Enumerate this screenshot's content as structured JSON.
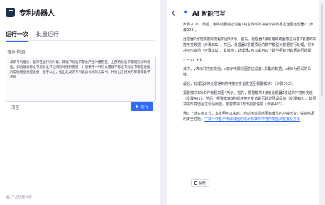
{
  "app": {
    "title": "专利机器人"
  },
  "tabs": [
    {
      "label": "运行一次",
      "active": true
    },
    {
      "label": "批量运行",
      "active": false
    }
  ],
  "form": {
    "section_label": "专利信息",
    "text_value": "发明专利描述：铝吊在运行的时候，其推节标准节都会产生冲撞形变，上部的标准节都成的诊断视图，如何设想标准节与标准节之间的冲撞形变值，计划采用一种可以用数字标准节标准节哪些连接的电磁线圈感应设备，基于以上，给出此发明专利说具体规的文案书，并给出了相关的算法或数学函数",
    "clear_label": "清空",
    "run_label": "运行"
  },
  "watermark": "产品经理大群",
  "panel": {
    "title": "AI 智能书写",
    "paragraphs": [
      "步骤202）。最后，电磁线圈感应设备1将监测到的冲撞形变数据发送至处理器2（步骤203）。",
      "处理器2处理数据的流程如图3所示。首先，处理器2接收电磁线圈感应设备1发送的冲撞形变数据（步骤301）。然后，处理器2根据预设的数学模型对数据进行处理，得到冲撞形变值（步骤302）。具体地，处理器2可以采用以下数学函数对数据进行处理：",
      "y = ax + b",
      "其中，y表示冲撞形变值，x表示电磁线圈感应设备1采集的数据，a和b为预设的系数。",
      "最后，处理器2将处理得到的冲撞形变值发送至报警模块3（步骤303）。",
      "报警模块3的工作流程如图4所示。首先，报警模块3接收处理器2发送的冲撞形变值（步骤401）。然后，报警模块3判断冲撞形变值是否超过预设阈值（步骤402）。如果冲撞形变值超过预设阈值，报警模块3发出报警信号（步骤403）。"
    ],
    "closing_text": "通过上述实施方式，本发明可以实时、自动地监测塔吊标准节的冲撞形变，提高塔吊的安全性能。",
    "closing_link": "下载一种基于电磁线圈的塔吊标准节冲撞形变监测装置及方法",
    "copy_label": "复制"
  }
}
